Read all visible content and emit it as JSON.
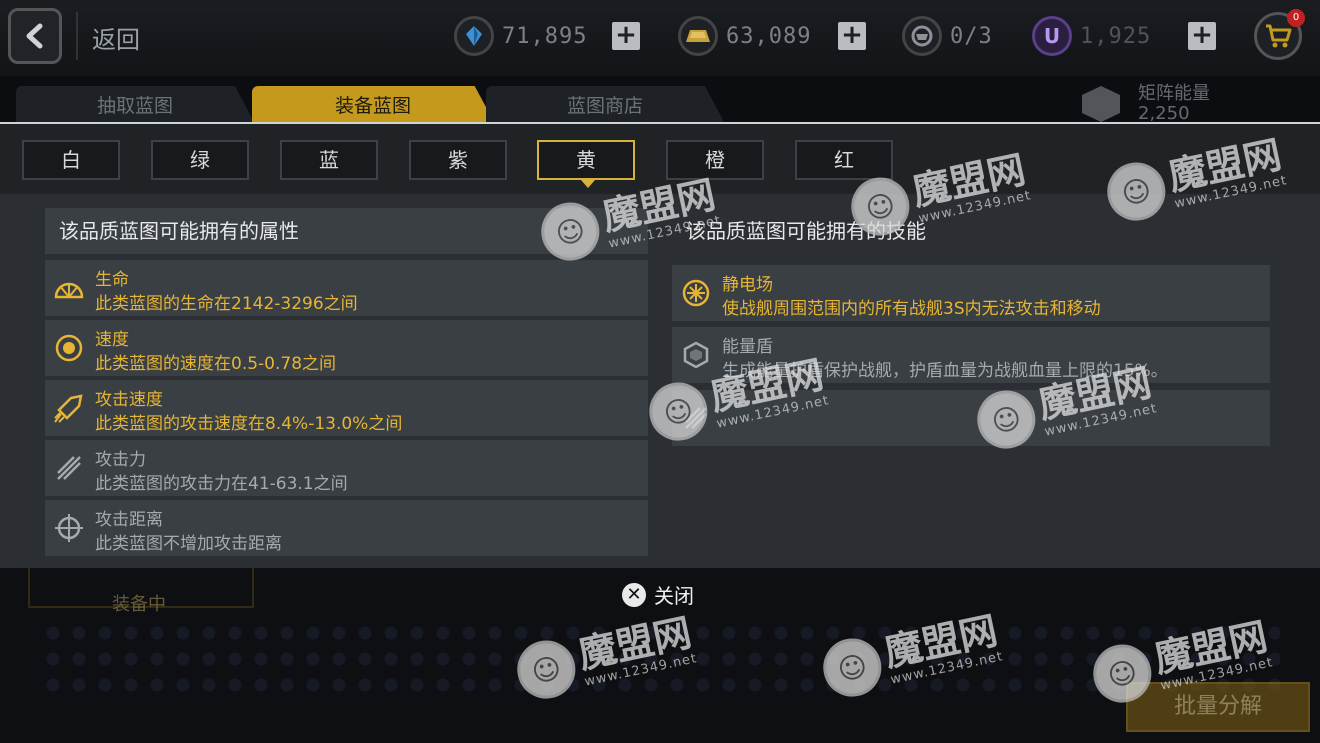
{
  "topbar": {
    "back_label": "返回",
    "resources": [
      {
        "name": "crystal",
        "icon": "crystal-icon",
        "value": "71,895"
      },
      {
        "name": "gold",
        "icon": "gold-bar-icon",
        "value": "63,089"
      },
      {
        "name": "stamina",
        "icon": "pilot-icon",
        "value": "0/3"
      },
      {
        "name": "u-coin",
        "icon": "u-coin-icon",
        "value": "1,925"
      }
    ],
    "cart_badge": "0"
  },
  "tabs": [
    {
      "label": "抽取蓝图",
      "active": false
    },
    {
      "label": "装备蓝图",
      "active": true
    },
    {
      "label": "蓝图商店",
      "active": false
    }
  ],
  "matrix": {
    "label": "矩阵能量",
    "value": "2,250"
  },
  "rarities": [
    {
      "label": "白",
      "active": false
    },
    {
      "label": "绿",
      "active": false
    },
    {
      "label": "蓝",
      "active": false
    },
    {
      "label": "紫",
      "active": false
    },
    {
      "label": "黄",
      "active": true
    },
    {
      "label": "橙",
      "active": false
    },
    {
      "label": "红",
      "active": false
    }
  ],
  "attributes": {
    "title": "该品质蓝图可能拥有的属性",
    "items": [
      {
        "icon": "health-icon",
        "name": "生命",
        "desc": "此类蓝图的生命在2142-3296之间",
        "highlight": true
      },
      {
        "icon": "speed-icon",
        "name": "速度",
        "desc": "此类蓝图的速度在0.5-0.78之间",
        "highlight": true
      },
      {
        "icon": "attack-speed-icon",
        "name": "攻击速度",
        "desc": "此类蓝图的攻击速度在8.4%-13.0%之间",
        "highlight": true
      },
      {
        "icon": "attack-power-icon",
        "name": "攻击力",
        "desc": "此类蓝图的攻击力在41-63.1之间",
        "highlight": false
      },
      {
        "icon": "crosshair-icon",
        "name": "攻击距离",
        "desc": "此类蓝图不增加攻击距离",
        "highlight": false
      }
    ]
  },
  "skills": {
    "title": "该品质蓝图可能拥有的技能",
    "items": [
      {
        "icon": "static-field-icon",
        "name": "静电场",
        "desc": "使战舰周围范围内的所有战舰3S内无法攻击和移动",
        "highlight": true
      },
      {
        "icon": "energy-shield-icon",
        "name": "能量盾",
        "desc": "生成能量护盾保护战舰，护盾血量为战舰血量上限的15%。",
        "highlight": false
      },
      {
        "icon": "speed-boost-icon",
        "name": "",
        "desc": "",
        "highlight": false
      }
    ]
  },
  "bottom": {
    "equipped_label": "装备中",
    "close_label": "关闭",
    "batch_label": "批量分解"
  },
  "watermark": {
    "brand": "魔盟网",
    "url": "www.12349.net"
  },
  "colors": {
    "accent": "#c59a1c",
    "highlight_text": "#e6b534",
    "panel": "#2b2f33",
    "row": "#3a3f44"
  }
}
